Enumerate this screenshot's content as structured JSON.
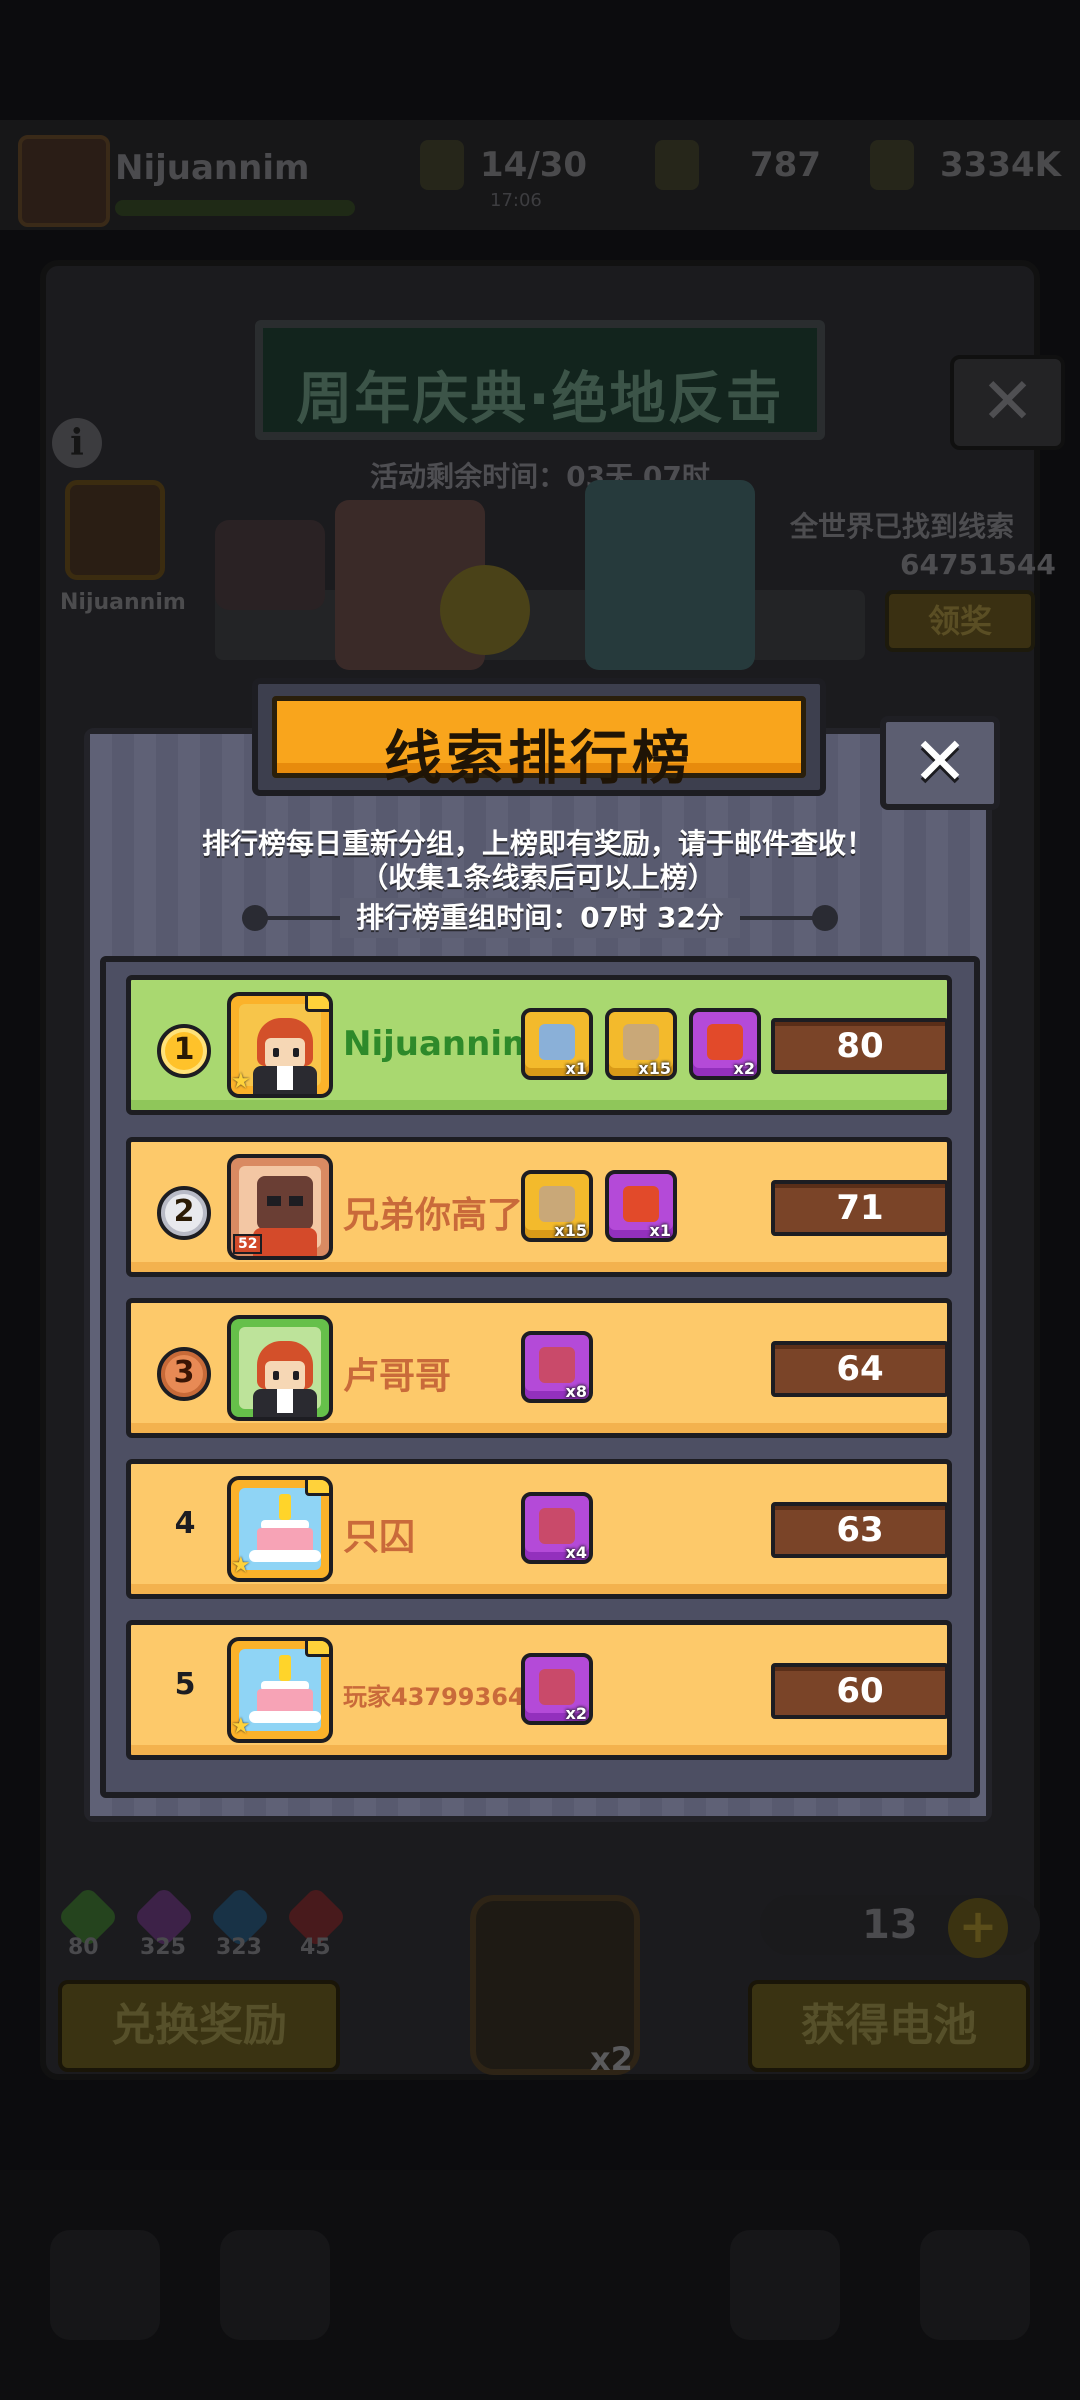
{
  "background": {
    "player_name": "Nijuannim",
    "stats": [
      {
        "value": "14/30",
        "sub": "17:06"
      },
      {
        "value": "787",
        "sub": ""
      },
      {
        "value": "3334K",
        "sub": ""
      }
    ],
    "event_title": "周年庆典·绝地反击",
    "event_timer": "活动剩余时间：03天 07时",
    "close_symbol": "✕",
    "info_symbol": "i",
    "side_player_name": "Nijuannim",
    "world_clues_label": "全世界已找到线索",
    "world_clues_count": "64751544",
    "claim_label": "领奖",
    "gems": [
      {
        "value": "80",
        "color": "#2f5a26"
      },
      {
        "value": "325",
        "color": "#4a2a5a"
      },
      {
        "value": "323",
        "color": "#1e3c52"
      },
      {
        "value": "45",
        "color": "#5a1f22"
      }
    ],
    "exchange_label": "兑换奖励",
    "get_battery_label": "获得电池",
    "battery_count": "13",
    "plus_symbol": "+",
    "magnifier_multiplier": "x2"
  },
  "modal": {
    "title": "线索排行榜",
    "close_symbol": "✕",
    "description_line1": "排行榜每日重新分组，上榜即有奖励，请于邮件查收！",
    "description_line2": "（收集1条线索后可以上榜）",
    "regroup_time": "排行榜重组时间：07时 32分",
    "rows": [
      {
        "rank": "1",
        "name": "Nijuannim",
        "score": "80",
        "rewards": [
          {
            "type": "chest",
            "count": "x1"
          },
          {
            "type": "chest",
            "count": "x15"
          },
          {
            "type": "gift",
            "count": "x2"
          }
        ]
      },
      {
        "rank": "2",
        "name": "兄弟你高了",
        "score": "71",
        "level": "52",
        "rewards": [
          {
            "type": "chest",
            "count": "x15"
          },
          {
            "type": "gift",
            "count": "x1"
          }
        ]
      },
      {
        "rank": "3",
        "name": "卢哥哥",
        "score": "64",
        "rewards": [
          {
            "type": "clue",
            "count": "x8"
          }
        ]
      },
      {
        "rank": "4",
        "name": "只囚",
        "score": "63",
        "rewards": [
          {
            "type": "clue",
            "count": "x4"
          }
        ]
      },
      {
        "rank": "5",
        "name": "玩家43799364",
        "score": "60",
        "rewards": [
          {
            "type": "clue",
            "count": "x2"
          }
        ]
      }
    ]
  },
  "colors": {
    "first_row": "#a9d870",
    "other_row": "#fdc96a",
    "title_bar": "#f9a51c",
    "score_box": "#7a4428",
    "modal_bg": "#5d5f74"
  }
}
